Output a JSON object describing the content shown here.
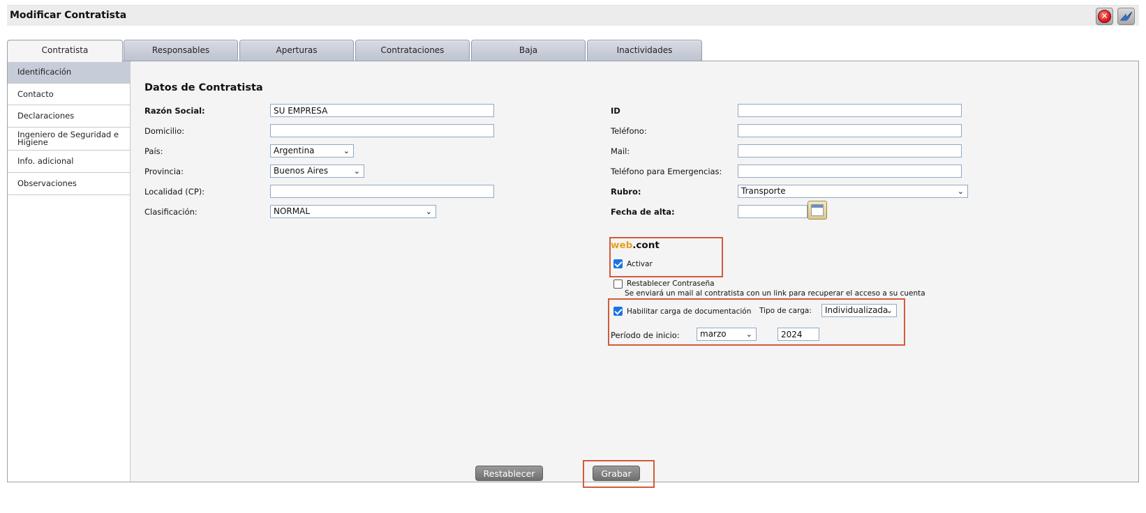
{
  "window": {
    "title": "Modificar Contratista"
  },
  "tabs": [
    {
      "label": "Contratista",
      "active": true
    },
    {
      "label": "Responsables"
    },
    {
      "label": "Aperturas"
    },
    {
      "label": "Contrataciones"
    },
    {
      "label": "Baja"
    },
    {
      "label": "Inactividades"
    }
  ],
  "sidebar": {
    "items": [
      {
        "label": "Identificación",
        "active": true
      },
      {
        "label": "Contacto"
      },
      {
        "label": "Declaraciones"
      },
      {
        "label": "Ingeniero de Seguridad e Higiene"
      },
      {
        "label": "Info. adicional"
      },
      {
        "label": "Observaciones"
      }
    ]
  },
  "form": {
    "section_title": "Datos de Contratista",
    "razon_social": {
      "label": "Razón Social:",
      "value": "SU EMPRESA"
    },
    "domicilio": {
      "label": "Domicilio:",
      "value": ""
    },
    "pais": {
      "label": "País:",
      "value": "Argentina"
    },
    "provincia": {
      "label": "Provincia:",
      "value": "Buenos Aires"
    },
    "localidad": {
      "label": "Localidad (CP):",
      "value": ""
    },
    "clasificacion": {
      "label": "Clasificación:",
      "value": "NORMAL"
    },
    "id": {
      "label": "ID",
      "value": ""
    },
    "telefono": {
      "label": "Teléfono:",
      "value": ""
    },
    "mail": {
      "label": "Mail:",
      "value": ""
    },
    "telefono_emergencias": {
      "label": "Teléfono para Emergencias:",
      "value": ""
    },
    "rubro": {
      "label": "Rubro:",
      "value": "Transporte"
    },
    "fecha_alta": {
      "label": "Fecha de alta:",
      "value": ""
    }
  },
  "webcont": {
    "brand_web": "web",
    "brand_cont": ".cont",
    "activar": {
      "label": "Activar",
      "checked": true
    },
    "restablecer": {
      "label": "Restablecer Contraseña",
      "checked": false,
      "hint": "Se enviará un mail al contratista con un link para recuperar el acceso a su cuenta"
    },
    "habilitar_carga": {
      "label": "Habilitar carga de documentación",
      "checked": true
    },
    "tipo_carga": {
      "label": "Tipo de carga:",
      "value": "Individualizada"
    },
    "periodo_inicio": {
      "label": "Período de inicio:",
      "month": "marzo",
      "year": "2024"
    }
  },
  "buttons": {
    "restablecer": "Restablecer",
    "grabar": "Grabar"
  },
  "icons": {
    "close": "close-icon",
    "back": "back-arrow-icon",
    "calendar": "calendar-icon",
    "dropdown": "chevron-down-icon"
  },
  "colors": {
    "highlight_box": "#d35a3a",
    "brand_orange": "#e8a020",
    "checkbox": "#1a73e8"
  }
}
